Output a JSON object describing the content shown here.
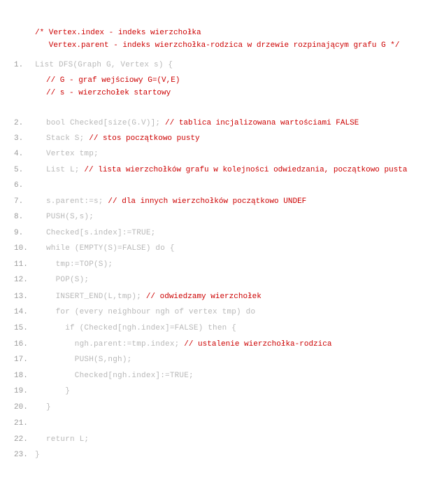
{
  "header_comment": [
    "/* Vertex.index - indeks wierzchołka",
    "   Vertex.parent - indeks wierzchołka-rodzica w drzewie rozpinającym grafu G */"
  ],
  "lines": [
    {
      "num": "1.",
      "code": "List DFS(Graph G, Vertex s) {",
      "comment": ""
    },
    {
      "num": "",
      "code": "",
      "comment": "// G - graf wejściowy G=(V,E)"
    },
    {
      "num": "",
      "code": "",
      "comment": "// s - wierzchołek startowy"
    },
    {
      "num": "2.",
      "code": "bool Checked[size(G.V)]; ",
      "comment": "// tablica incjalizowana wartościami FALSE"
    },
    {
      "num": "3.",
      "code": "Stack S; ",
      "comment": "// stos początkowo pusty"
    },
    {
      "num": "4.",
      "code": "Vertex tmp;",
      "comment": ""
    },
    {
      "num": "5.",
      "code": "List L; ",
      "comment": "// lista wierzchołków grafu w kolejności odwiedzania, początkowo pusta"
    },
    {
      "num": "6.",
      "code": "",
      "comment": ""
    },
    {
      "num": "7.",
      "code": "s.parent:=s; ",
      "comment": "// dla innych wierzchołków początkowo UNDEF"
    },
    {
      "num": "8.",
      "code": "PUSH(S,s);",
      "comment": ""
    },
    {
      "num": "9.",
      "code": "Checked[s.index]:=TRUE;",
      "comment": ""
    },
    {
      "num": "10.",
      "code": "while (EMPTY(S)=FALSE) do {",
      "comment": ""
    },
    {
      "num": "11.",
      "code": "  tmp:=TOP(S);",
      "comment": ""
    },
    {
      "num": "12.",
      "code": "  POP(S);",
      "comment": ""
    },
    {
      "num": "13.",
      "code": "  INSERT_END(L,tmp); ",
      "comment": "// odwiedzamy wierzchołek"
    },
    {
      "num": "14.",
      "code": "  for (every neighbour ngh of vertex tmp) do",
      "comment": ""
    },
    {
      "num": "15.",
      "code": "    if (Checked[ngh.index]=FALSE) then {",
      "comment": ""
    },
    {
      "num": "16.",
      "code": "      ngh.parent:=tmp.index; ",
      "comment": "// ustalenie wierzchołka-rodzica"
    },
    {
      "num": "17.",
      "code": "      PUSH(S,ngh);",
      "comment": ""
    },
    {
      "num": "18.",
      "code": "      Checked[ngh.index]:=TRUE;",
      "comment": ""
    },
    {
      "num": "19.",
      "code": "    }",
      "comment": ""
    },
    {
      "num": "20.",
      "code": "}",
      "comment": ""
    },
    {
      "num": "21.",
      "code": "",
      "comment": ""
    },
    {
      "num": "22.",
      "code": "return L;",
      "comment": ""
    },
    {
      "num": "23.",
      "code": "}",
      "comment": ""
    }
  ],
  "colors": {
    "comment": "#cc0000",
    "code": "#b8b8b8",
    "line_number": "#9a9a9a",
    "background": "#ffffff"
  }
}
